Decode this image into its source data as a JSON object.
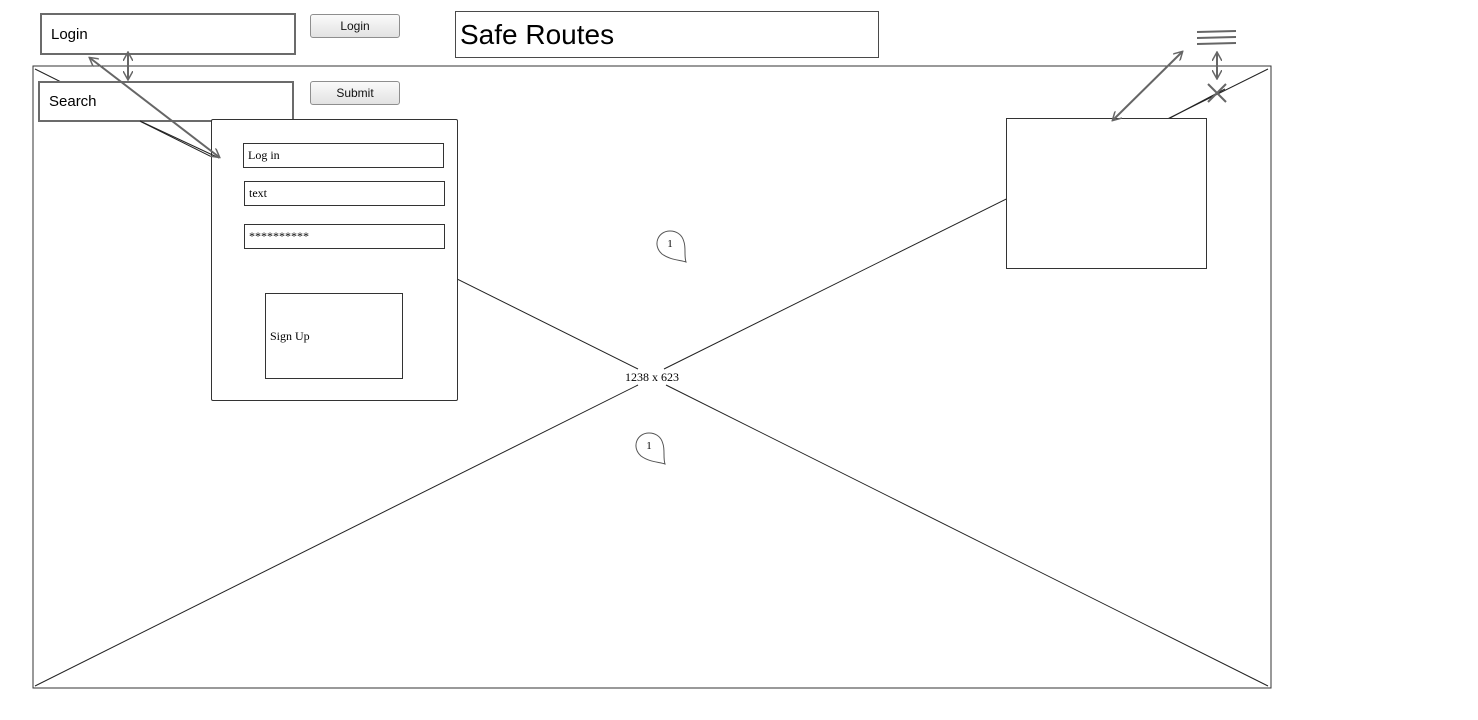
{
  "header": {
    "login_field_label": "Login",
    "login_button_label": "Login",
    "title": "Safe Routes",
    "search_field_label": "Search",
    "submit_button_label": "Submit"
  },
  "placeholder": {
    "dimension_label": "1238 x 623"
  },
  "login_panel": {
    "login_field": "Log in",
    "text_field": "text",
    "password_field": "**********",
    "signup_label": "Sign Up"
  },
  "pins": [
    {
      "label": "1"
    },
    {
      "label": "1"
    }
  ],
  "icons": {
    "menu": "hamburger-icon",
    "close": "close-icon"
  }
}
